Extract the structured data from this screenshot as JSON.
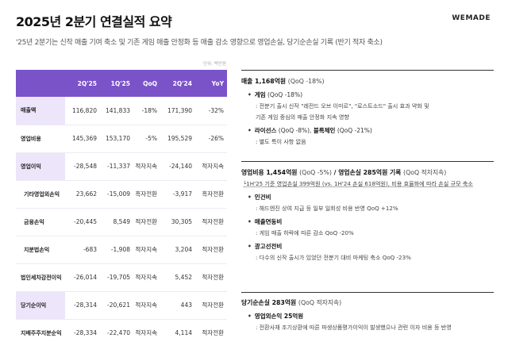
{
  "header": {
    "title": "2025년 2분기 연결실적 요약",
    "logo": "WEMADE",
    "subtitle": "'25년 2분기는 신작 매출 기여 축소 및 기존 게임 매출 안정화 등 매출 감소 영향으로 영업손실, 당기순손실 기록 (반기 적자 축소)",
    "unit": "단위: 백만원"
  },
  "table": {
    "columns": [
      "",
      "2Q'25",
      "1Q'25",
      "QoQ",
      "2Q'24",
      "YoY"
    ],
    "rows": [
      {
        "label": "매출액",
        "cells": [
          "116,820",
          "141,833",
          "-18%",
          "171,390",
          "-32%"
        ]
      },
      {
        "label": "영업비용",
        "cells": [
          "145,369",
          "153,170",
          "-5%",
          "195,529",
          "-26%"
        ]
      },
      {
        "label": "영업이익",
        "cells": [
          "-28,548",
          "-11,337",
          "적자지속",
          "-24,140",
          "적자지속"
        ]
      },
      {
        "label": "기타영업외손익",
        "cells": [
          "23,662",
          "-15,009",
          "흑자전환",
          "-3,917",
          "흑자전환"
        ]
      },
      {
        "label": "금융손익",
        "cells": [
          "-20,445",
          "8,549",
          "적자전환",
          "30,305",
          "적자전환"
        ]
      },
      {
        "label": "지분법손익",
        "cells": [
          "-683",
          "-1,908",
          "적자지속",
          "3,204",
          "적자전환"
        ]
      },
      {
        "label": "법인세차감전이익",
        "cells": [
          "-26,014",
          "-19,705",
          "적자지속",
          "5,452",
          "적자전환"
        ]
      },
      {
        "label": "당기순이익",
        "cells": [
          "-28,314",
          "-20,621",
          "적자지속",
          "443",
          "적자전환"
        ]
      },
      {
        "label": "지배주주지분순익",
        "cells": [
          "-28,334",
          "-22,470",
          "적자지속",
          "4,114",
          "적자전환"
        ]
      }
    ]
  },
  "revenue": {
    "heading": "매출 1,168억원",
    "heading_detail": "(QoQ -18%)",
    "game_label": "게임",
    "game_detail": "(QoQ -18%)",
    "game_desc_1": ": 전분기 출시 신작 \"레전드 오브 이미르\", \"로스트소드\" 출시 효과 약화 및",
    "game_desc_2": "기존 게임 중심의 매출 안정화 지속 영향",
    "license_label": "라이선스",
    "license_detail": "(QoQ -8%)",
    "blockchain_label": "블록체인",
    "blockchain_detail": "(QoQ -21%)",
    "license_desc": ": 별도 특이 사항 없음"
  },
  "costs": {
    "heading": "영업비용 1,454억원",
    "heading_detail": "(QoQ -5%)",
    "loss_heading": "영업손실 285억원 기록",
    "loss_detail": "(QoQ 적자지속)",
    "note": "└1H'25 기준 영업손실 399억원 (vs. 1H'24 손실 618억원), 비용 효율화에 따라 손실 규모 축소",
    "labor_label": "인건비",
    "labor_desc": ": 해드엔진 상여 지급 등 일부 일회성 비용 반영 QoQ +12%",
    "fee_label": "매출연동비",
    "fee_desc": ": 게임 매출 하락에 따른 감소 QoQ -20%",
    "ad_label": "광고선전비",
    "ad_desc": ": 다수의 신작 출시가 있었던 전분기 대비 마케팅 축소 QoQ -23%"
  },
  "net": {
    "heading": "당기순손실 283억원",
    "heading_detail": "(QoQ 적자지속)",
    "nonop_label": "영업외손익 25억원",
    "nonop_desc": ": 전환사채 조기상환에 따른 파생상품평가이익이 발생했으나 관련 이자 비용 등 반영"
  }
}
